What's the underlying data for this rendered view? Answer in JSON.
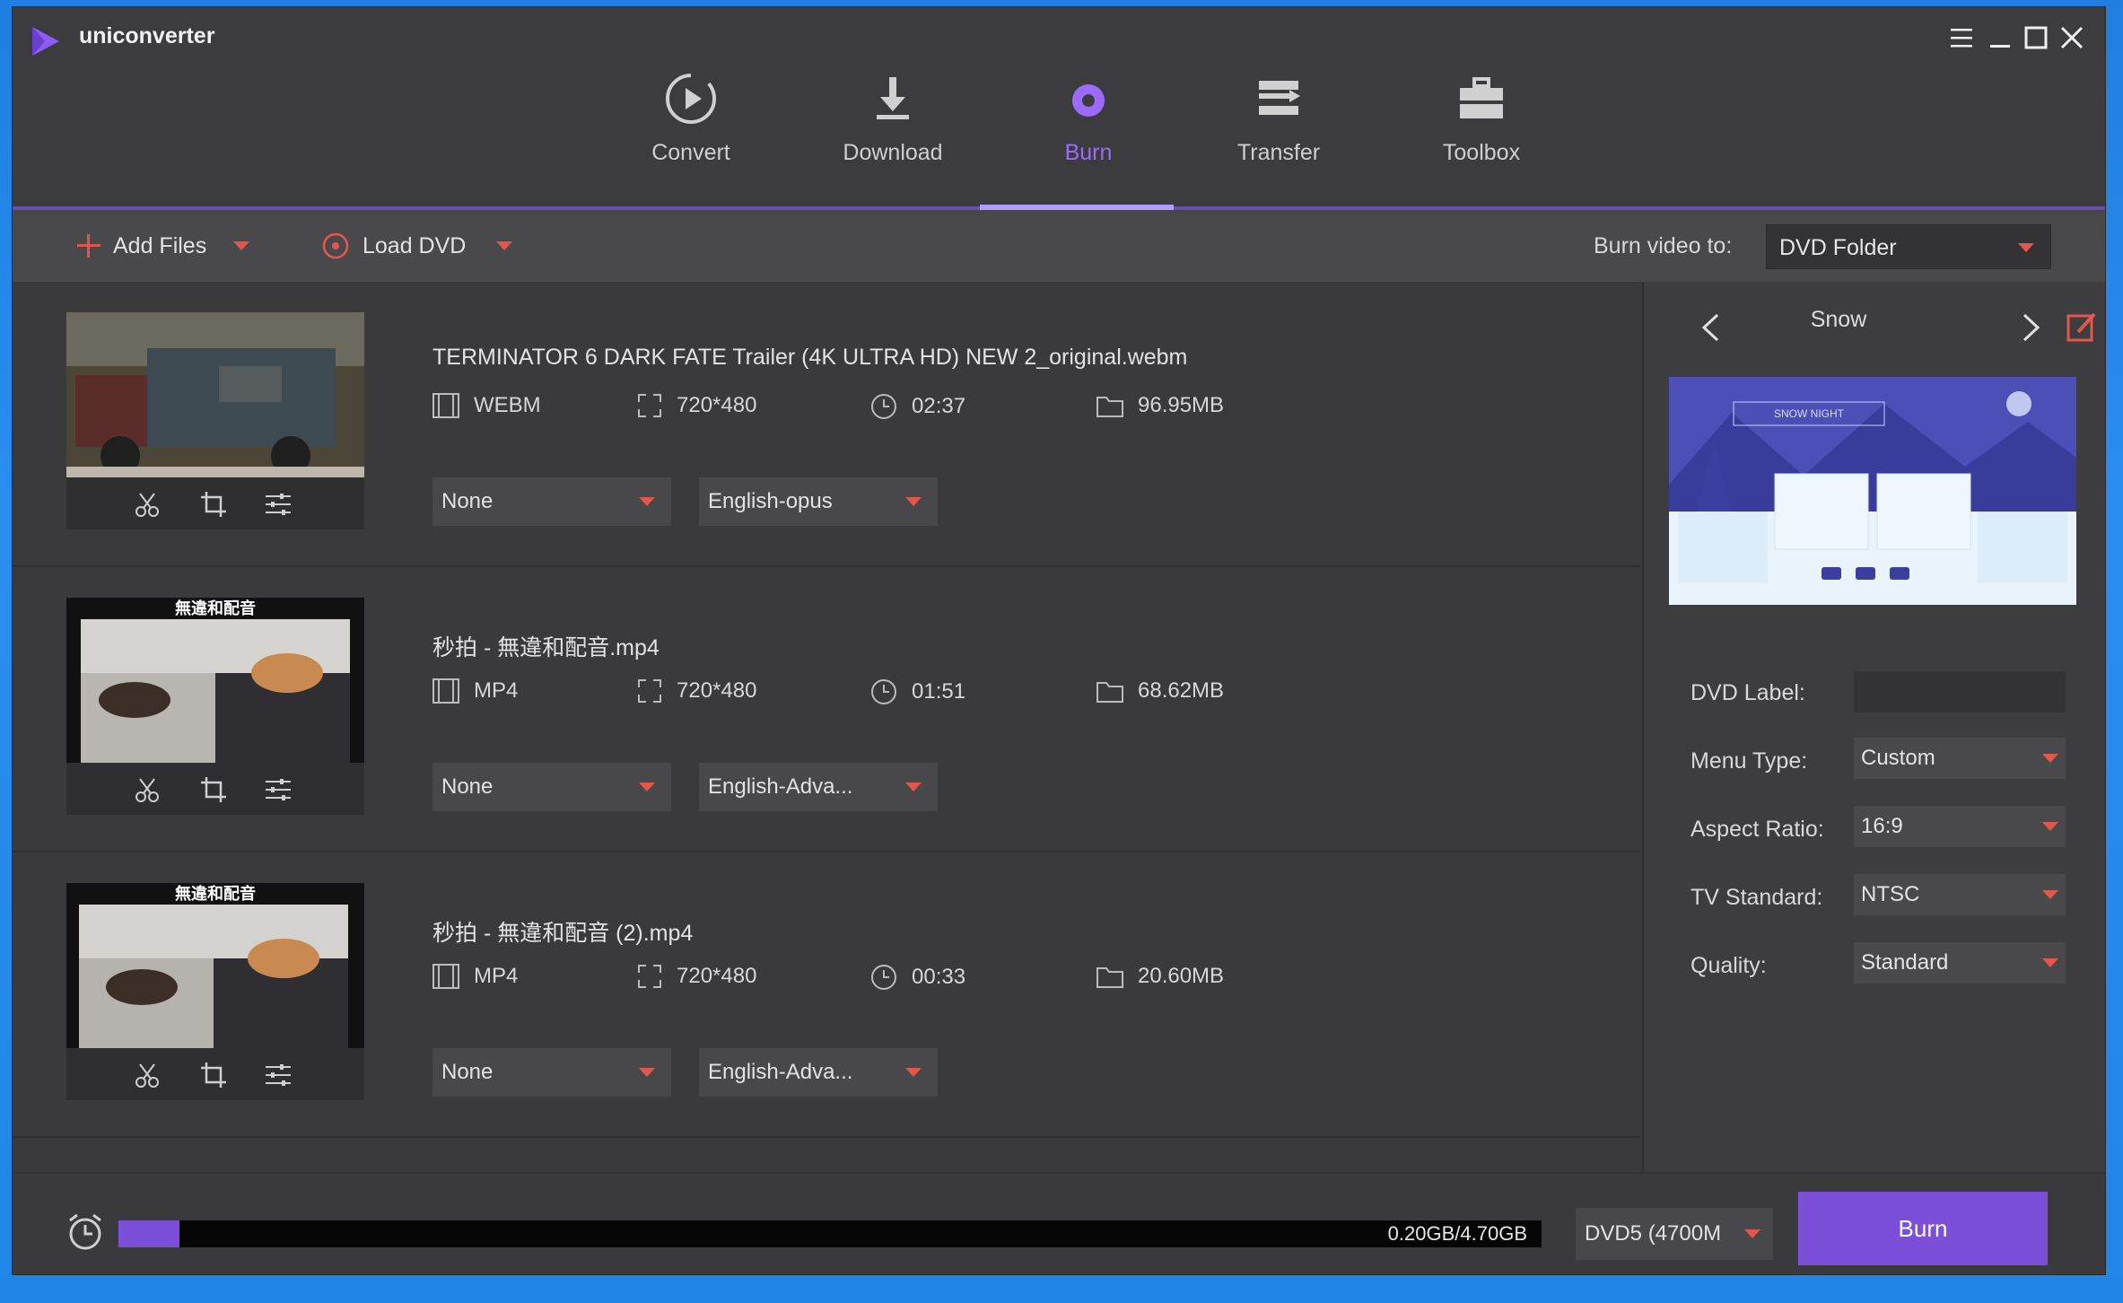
{
  "app": {
    "title": "uniconverter"
  },
  "nav": [
    {
      "label": "Convert",
      "icon": "play-circle-icon"
    },
    {
      "label": "Download",
      "icon": "download-icon"
    },
    {
      "label": "Burn",
      "icon": "disc-icon"
    },
    {
      "label": "Transfer",
      "icon": "transfer-icon"
    },
    {
      "label": "Toolbox",
      "icon": "toolbox-icon"
    }
  ],
  "toolbar": {
    "add_files": "Add Files",
    "load_dvd": "Load DVD",
    "burn_to_label": "Burn video to:",
    "burn_to_value": "DVD Folder"
  },
  "files": [
    {
      "name": "TERMINATOR 6 DARK FATE Trailer (4K ULTRA HD) NEW 2_original.webm",
      "format": "WEBM",
      "resolution": "720*480",
      "duration": "02:37",
      "size": "96.95MB",
      "subtitle": "None",
      "audio": "English-opus"
    },
    {
      "name": "秒拍 - 無違和配音.mp4",
      "format": "MP4",
      "resolution": "720*480",
      "duration": "01:51",
      "size": "68.62MB",
      "subtitle": "None",
      "audio": "English-Adva...",
      "thumb_caption": "無違和配音"
    },
    {
      "name": "秒拍 - 無違和配音 (2).mp4",
      "format": "MP4",
      "resolution": "720*480",
      "duration": "00:33",
      "size": "20.60MB",
      "subtitle": "None",
      "audio": "English-Adva...",
      "thumb_caption": "無違和配音"
    }
  ],
  "panel": {
    "theme": "Snow",
    "preview_title": "SNOW NIGHT",
    "dvd_label_label": "DVD Label:",
    "dvd_label_value": "",
    "menu_type_label": "Menu Type:",
    "menu_type_value": "Custom",
    "aspect_ratio_label": "Aspect Ratio:",
    "aspect_ratio_value": "16:9",
    "tv_standard_label": "TV Standard:",
    "tv_standard_value": "NTSC",
    "quality_label": "Quality:",
    "quality_value": "Standard"
  },
  "bottom": {
    "usage_text": "0.20GB/4.70GB",
    "usage_fraction": 0.0426,
    "disc_type": "DVD5 (4700M",
    "burn_label": "Burn"
  },
  "colors": {
    "accent": "#7b4fd8",
    "caret": "#e2574c",
    "background": "#3a3a3d"
  }
}
